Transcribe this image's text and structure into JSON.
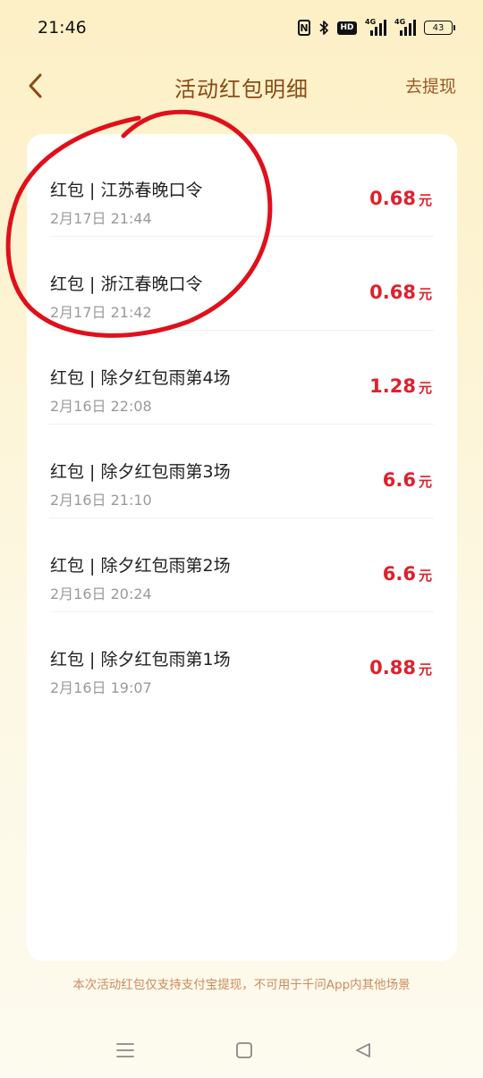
{
  "status_bar": {
    "time": "21:46",
    "nfc_label": "N",
    "hd_label": "HD",
    "sim1_label": "4G",
    "sim2_label": "4G",
    "battery_level": "43"
  },
  "header": {
    "title": "活动红包明细",
    "back_icon": "chevron-left-icon",
    "withdraw_label": "去提现"
  },
  "records": [
    {
      "title": "红包 | 江苏春晚口令",
      "date": "2月17日 21:44",
      "amount": "0.68",
      "unit": "元"
    },
    {
      "title": "红包 | 浙江春晚口令",
      "date": "2月17日 21:42",
      "amount": "0.68",
      "unit": "元"
    },
    {
      "title": "红包 | 除夕红包雨第4场",
      "date": "2月16日 22:08",
      "amount": "1.28",
      "unit": "元"
    },
    {
      "title": "红包 | 除夕红包雨第3场",
      "date": "2月16日 21:10",
      "amount": "6.6",
      "unit": "元"
    },
    {
      "title": "红包 | 除夕红包雨第2场",
      "date": "2月16日 20:24",
      "amount": "6.6",
      "unit": "元"
    },
    {
      "title": "红包 | 除夕红包雨第1场",
      "date": "2月16日 19:07",
      "amount": "0.88",
      "unit": "元"
    }
  ],
  "footnote": "本次活动红包仅支持支付宝提现，不可用于千问App内其他场景",
  "navbar": {
    "menu_icon": "menu-icon",
    "home_icon": "square-home-icon",
    "back_icon": "triangle-back-icon"
  },
  "colors": {
    "amount_red": "#e0202c",
    "title_brown": "#8a4a14",
    "annotation_red": "#e0101a"
  }
}
